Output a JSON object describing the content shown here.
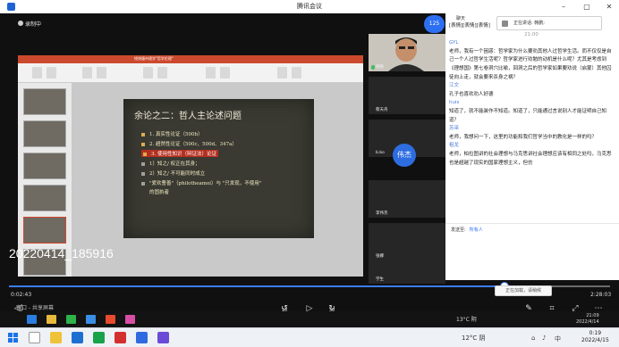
{
  "window": {
    "title": "腾讯会议",
    "minimize": "–",
    "restore": "▢",
    "close": "✕"
  },
  "recording": {
    "label": "录制中"
  },
  "ppt": {
    "title_text": "钱钱塘市理学\"哲学伦理\""
  },
  "slide": {
    "title": "余论之二：哲人主论述问题",
    "bullets": [
      "1. 真实性论证（500b）",
      "2. 超然性论证（500c、500d、347a）",
      "3. 使用性知识（辩证法）论证",
      "1）知之/ 权正在其身；",
      "2）知之/ 不可能同时成立",
      "\"爱欢曹善\"（philotheamoi）与 \"只发现，不使用\"",
      "的固执者"
    ]
  },
  "participant_count": "125",
  "participants": [
    {
      "name": "韩鹏"
    },
    {
      "name": "蔡天舟"
    },
    {
      "name": "b.bo"
    },
    {
      "name": "伟杰",
      "avatar_text": "伟杰"
    },
    {
      "name": "李伟杰"
    },
    {
      "name": "张娜"
    },
    {
      "name": "学生"
    }
  ],
  "chat": {
    "header": "聊天",
    "speaking": "正在讲话: 韩鹏;",
    "messages": [
      {
        "text": "[表情][表情][表情]"
      },
      {
        "time": "21:00"
      },
      {
        "sender": "GYL",
        "text": "老师，我有一个困惑：哲学家为什么要劝其他人过哲学生活。而不仅仅是自己一个人过哲学生活呢？哲学家进行劝勉的动机是什么呢？尤其是考虑到《理想国》第七卷洞穴比喻，回洞之后的哲学家如果要劝说（启蒙）其他囚徒向上走，就会要来杀身之祸？"
      },
      {
        "sender": "江文",
        "text": "孔子也喜欢劝人好德"
      },
      {
        "sender": "huis",
        "text": "知道了，就不能装作不知道。知道了，只能通过言说别人才能证明自己知道？"
      },
      {
        "sender": "苏巫",
        "text": "老师，我想问一下，这里的功能和我们哲学当中的教化是一样的吗？"
      },
      {
        "sender": "祖龙",
        "text": "老师，柏拉图讲的社会理想与马克思讲社会理想应该有相同之处吗，马克思也是超越了现实的国家理想主义，但仿"
      }
    ],
    "send_to_label": "发送至:",
    "send_to_value": "所有人"
  },
  "player": {
    "filename": "2022041​4_185916",
    "current_time": "0:02:43",
    "total_time": "2:28:03",
    "progress": 0.825,
    "rewind_label": "10",
    "forward_label": "30",
    "tooltip": "正在加载，请稍候",
    "caption": "窗口 - 共享屏幕"
  },
  "inner_taskbar": {
    "weather": "13°C 阴",
    "time": "21:09",
    "date": "2022/4/14"
  },
  "taskbar": {
    "weather": "12°C 阴",
    "time": "0:19",
    "date": "2022/4/15",
    "lang": "中"
  }
}
